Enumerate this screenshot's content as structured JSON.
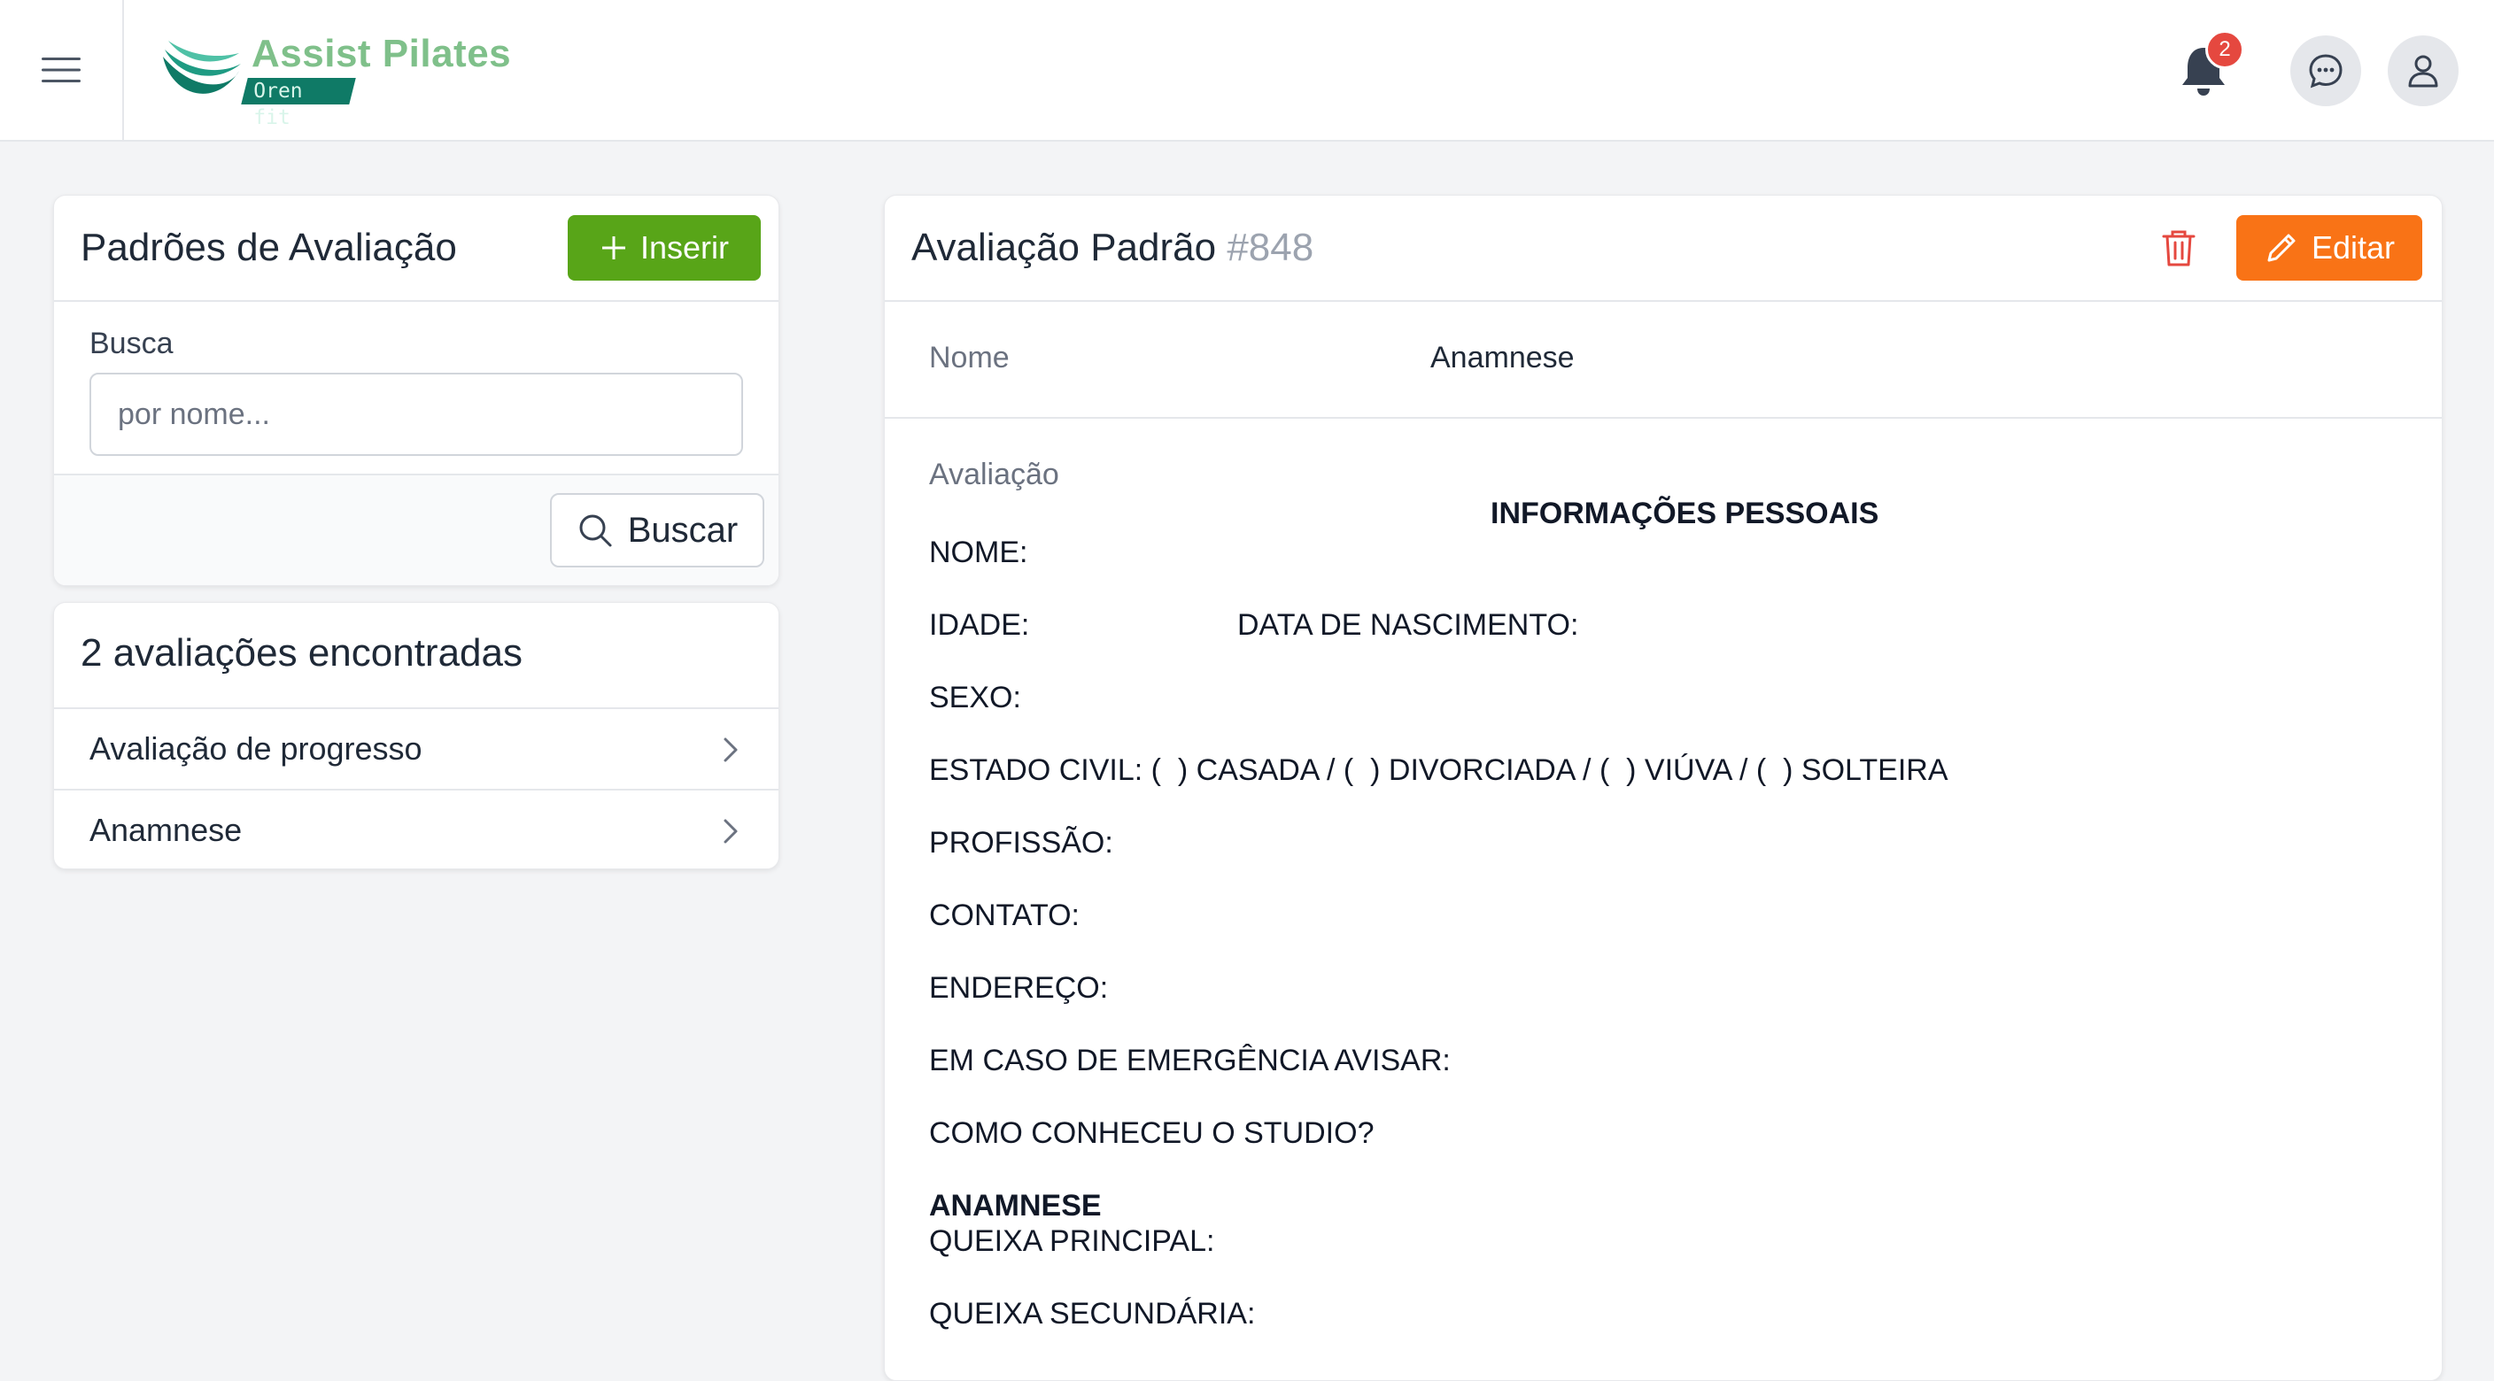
{
  "header": {
    "brand_title": "Assist Pilates",
    "brand_subtitle": "Oren fit",
    "notification_count": "2",
    "icons": [
      "hamburger-menu-icon",
      "bell-icon",
      "chat-icon",
      "user-icon"
    ]
  },
  "colors": {
    "green_button": "#58a518",
    "orange_button": "#f97316",
    "badge": "#e5483f",
    "brand": "#7fc08a",
    "brand_dark": "#0f7a66"
  },
  "left_panel": {
    "title": "Padrões de Avaliação",
    "insert_label": "Inserir",
    "search_label": "Busca",
    "search_placeholder": "por nome...",
    "search_button": "Buscar"
  },
  "results": {
    "title": "2 avaliações encontradas",
    "items": [
      {
        "label": "Avaliação de progresso"
      },
      {
        "label": "Anamnese"
      }
    ]
  },
  "detail": {
    "title": "Avaliação Padrão",
    "id": "#848",
    "edit_label": "Editar",
    "name_label": "Nome",
    "name_value": "Anamnese",
    "evaluation_label": "Avaliação",
    "heading": "INFORMAÇÕES PESSOAIS",
    "lines": {
      "nome": "NOME:",
      "idade": "IDADE:",
      "nascimento": "DATA DE NASCIMENTO:",
      "sexo": "SEXO:",
      "estado_civil": "ESTADO CIVIL: (  ) CASADA / (  ) DIVORCIADA / (  ) VIÚVA / (  ) SOLTEIRA",
      "profissao": "PROFISSÃO:",
      "contato": "CONTATO:",
      "endereco": "ENDEREÇO:",
      "emergencia": "EM CASO DE EMERGÊNCIA AVISAR:",
      "como_conheceu": "COMO CONHECEU O STUDIO?",
      "anamnese_heading": "ANAMNESE",
      "queixa_principal": "QUEIXA PRINCIPAL:",
      "queixa_secundaria": "QUEIXA SECUNDÁRIA:"
    }
  }
}
